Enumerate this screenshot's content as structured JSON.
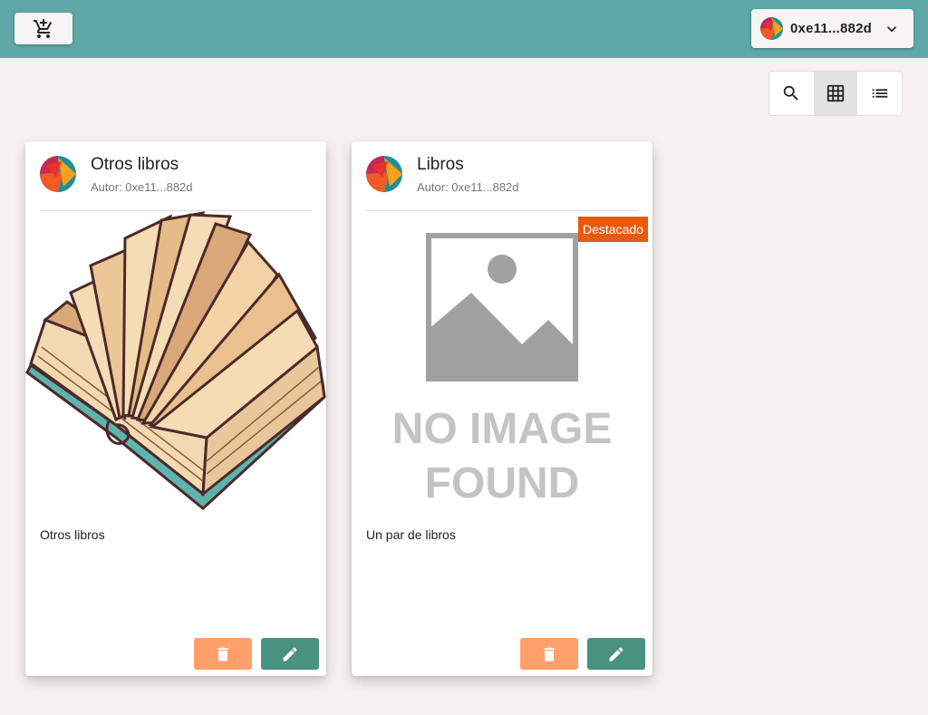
{
  "topbar": {
    "cart_icon": "add-shopping-cart-icon",
    "account": {
      "address": "0xe11...882d",
      "icon": "chevron-down-icon"
    }
  },
  "view_toggle": {
    "options": [
      {
        "icon": "search-icon",
        "active": false
      },
      {
        "icon": "grid-view-icon",
        "active": true
      },
      {
        "icon": "list-view-icon",
        "active": false
      }
    ]
  },
  "colors": {
    "topbar": "#5fa8a7",
    "delete_button": "#ffa06a",
    "edit_button": "#4a9280",
    "badge": "#e95a0c",
    "background": "#f6f0f0"
  },
  "cards": [
    {
      "title": "Otros libros",
      "author": "Autor: 0xe11...882d",
      "image": "open-book-illustration",
      "description": "Otros libros",
      "badge": ""
    },
    {
      "title": "Libros",
      "author": "Autor: 0xe11...882d",
      "image": "no-image-found-placeholder",
      "image_text_line1": "NO IMAGE",
      "image_text_line2": "FOUND",
      "description": "Un par de libros",
      "badge": "Destacado"
    }
  ]
}
